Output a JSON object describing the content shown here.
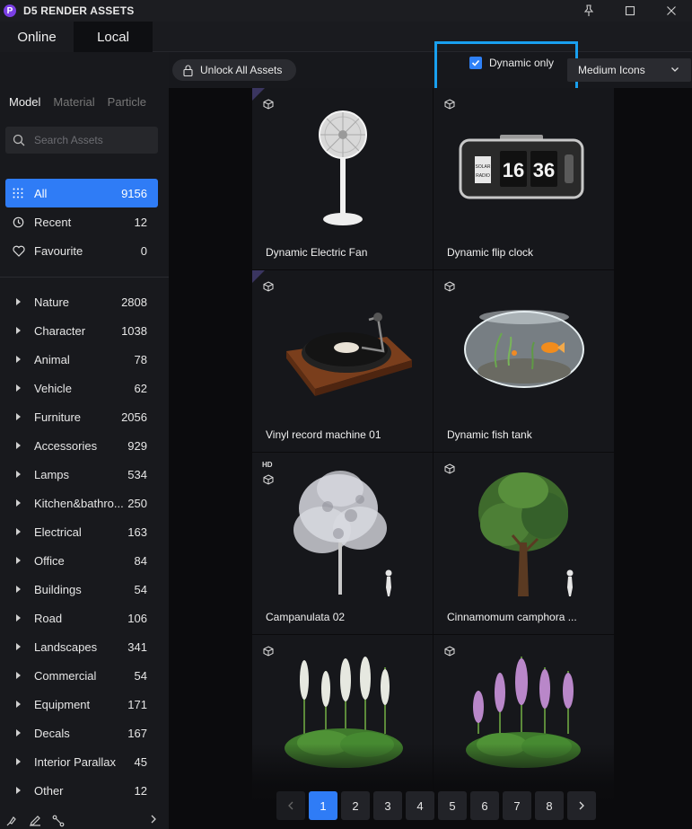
{
  "app": {
    "title": "D5 RENDER ASSETS",
    "logo_letter": "P"
  },
  "source_tabs": [
    "Online",
    "Local"
  ],
  "toolbar": {
    "unlock_label": "Unlock All Assets",
    "dynamic_only_label": "Dynamic only",
    "dynamic_only_checked": true,
    "icon_size": "Medium Icons"
  },
  "sidebar": {
    "category_tabs": [
      "Model",
      "Material",
      "Particle"
    ],
    "search_placeholder": "Search Assets",
    "quick": [
      {
        "label": "All",
        "count": "9156",
        "icon": "grid-dots-icon"
      },
      {
        "label": "Recent",
        "count": "12",
        "icon": "history-icon"
      },
      {
        "label": "Favourite",
        "count": "0",
        "icon": "heart-icon"
      }
    ],
    "categories": [
      {
        "label": "Nature",
        "count": "2808"
      },
      {
        "label": "Character",
        "count": "1038"
      },
      {
        "label": "Animal",
        "count": "78"
      },
      {
        "label": "Vehicle",
        "count": "62"
      },
      {
        "label": "Furniture",
        "count": "2056"
      },
      {
        "label": "Accessories",
        "count": "929"
      },
      {
        "label": "Lamps",
        "count": "534"
      },
      {
        "label": "Kitchen&bathro...",
        "count": "250"
      },
      {
        "label": "Electrical",
        "count": "163"
      },
      {
        "label": "Office",
        "count": "84"
      },
      {
        "label": "Buildings",
        "count": "54"
      },
      {
        "label": "Road",
        "count": "106"
      },
      {
        "label": "Landscapes",
        "count": "341"
      },
      {
        "label": "Commercial",
        "count": "54"
      },
      {
        "label": "Equipment",
        "count": "171"
      },
      {
        "label": "Decals",
        "count": "167"
      },
      {
        "label": "Interior Parallax",
        "count": "45"
      },
      {
        "label": "Other",
        "count": "12"
      }
    ]
  },
  "assets": [
    {
      "name": "Dynamic Electric Fan",
      "hd": ""
    },
    {
      "name": "Dynamic flip clock",
      "hd": "",
      "clock_left": "SOLAR",
      "clock_right": "RADIO",
      "clock_h": "16",
      "clock_m": "36"
    },
    {
      "name": "Vinyl record machine 01",
      "hd": ""
    },
    {
      "name": "Dynamic fish tank",
      "hd": ""
    },
    {
      "name": "Campanulata 02",
      "hd": "HD"
    },
    {
      "name": "Cinnamomum camphora ...",
      "hd": ""
    },
    {
      "name": "",
      "hd": ""
    },
    {
      "name": "",
      "hd": ""
    }
  ],
  "pagination": {
    "pages": [
      "1",
      "2",
      "3",
      "4",
      "5",
      "6",
      "7",
      "8"
    ],
    "current": "1"
  },
  "colors": {
    "accent": "#2f7cf6",
    "highlight_box": "#19a0ef",
    "logo": "#7b3fe4"
  }
}
